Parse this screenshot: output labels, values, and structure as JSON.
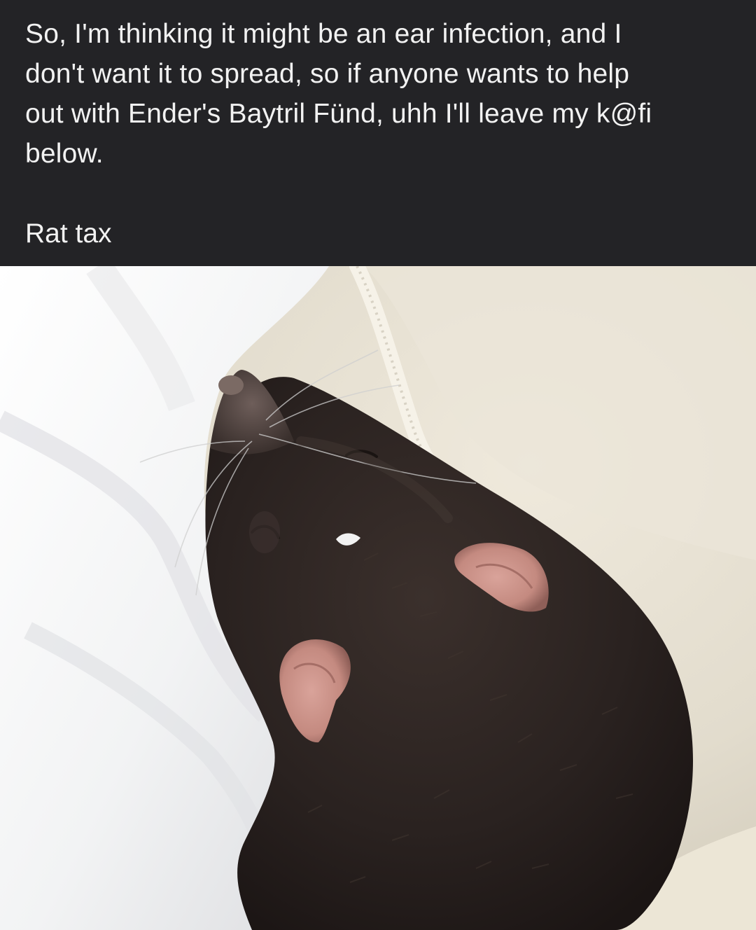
{
  "post": {
    "text_lines": [
      "So, I'm thinking it might be an ear infection, and I",
      "don't want it to spread, so if anyone wants to help",
      "out with Ender's Baytril Fünd, uhh I'll leave my k@fi",
      "below."
    ],
    "tag_line": "Rat tax"
  },
  "photo": {
    "subject": "sleeping dark brown rat nestled in white fleece blanket",
    "colors": {
      "fur": "#2a2220",
      "fleece": "#f4f4f3",
      "cream_fabric": "#e8e2d3",
      "ear_pink": "#c48a80"
    }
  }
}
